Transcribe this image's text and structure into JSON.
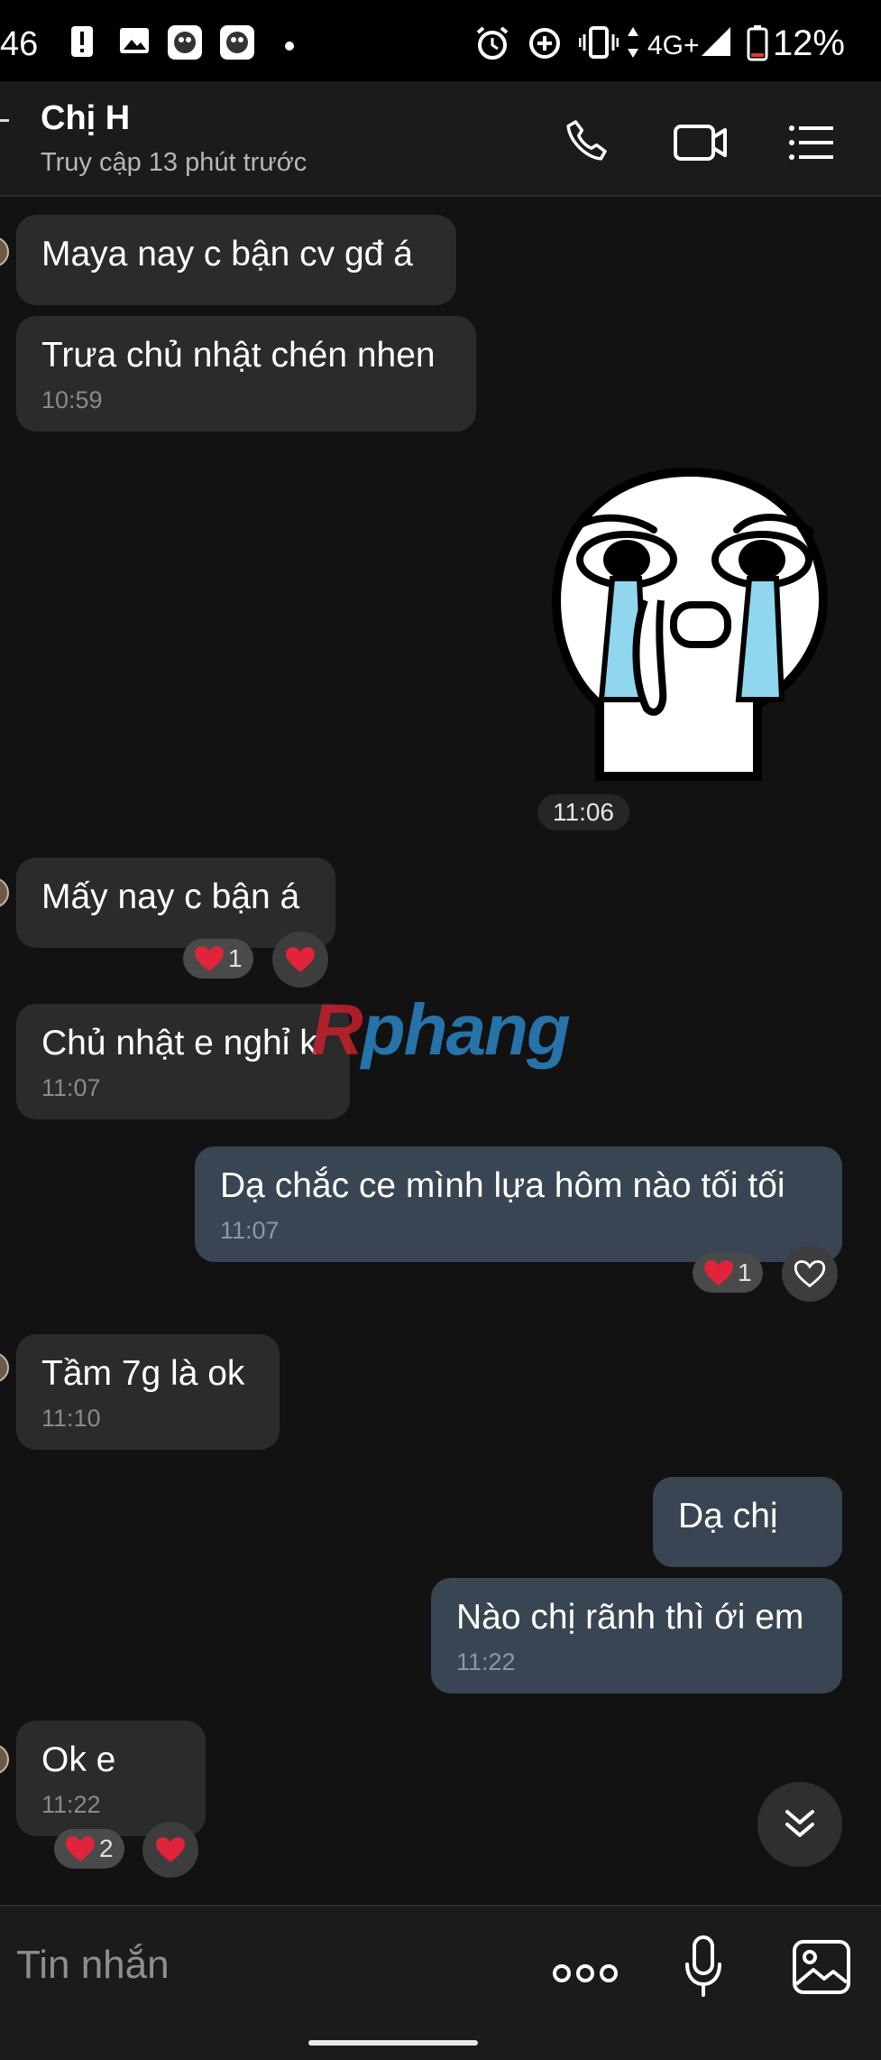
{
  "status_bar": {
    "time": "46",
    "network": "4G+",
    "battery": "12%"
  },
  "header": {
    "name": "Chị H",
    "status": "Truy cập 13 phút trước",
    "icons": [
      "back-arrow-icon",
      "phone-icon",
      "video-call-icon",
      "menu-icon"
    ]
  },
  "messages": [
    {
      "dir": "in",
      "text": "Maya nay c bận cv gđ á",
      "time": ""
    },
    {
      "dir": "in",
      "text": "Trưa chủ nhật chén nhen",
      "time": "10:59"
    },
    {
      "dir": "out",
      "type": "sticker",
      "sticker": "crying-face",
      "time": "11:06"
    },
    {
      "dir": "in",
      "text": "Mấy nay c bận á",
      "time": "",
      "reaction_count": "1"
    },
    {
      "dir": "in",
      "text": "Chủ nhật e nghỉ k",
      "time": "11:07"
    },
    {
      "dir": "out",
      "text": "Dạ chắc ce mình lựa hôm nào tối tối",
      "time": "11:07",
      "reaction_count": "1"
    },
    {
      "dir": "in",
      "text": "Tầm 7g là ok",
      "time": "11:10"
    },
    {
      "dir": "out",
      "text": "Dạ chị",
      "time": ""
    },
    {
      "dir": "out",
      "text": "Nào chị rãnh thì ới em",
      "time": "11:22"
    },
    {
      "dir": "in",
      "text": "Ok e",
      "time": "11:22",
      "reaction_count": "2"
    }
  ],
  "watermark": {
    "a": "R",
    "b": "phang"
  },
  "composer": {
    "placeholder": "Tin nhắn",
    "icons": [
      "more-icon",
      "microphone-icon",
      "image-icon"
    ]
  },
  "colors": {
    "background": "#121212",
    "incoming_bubble": "#2b2b2b",
    "outgoing_bubble": "#3a4553",
    "reaction_heart": "#e0243b"
  }
}
